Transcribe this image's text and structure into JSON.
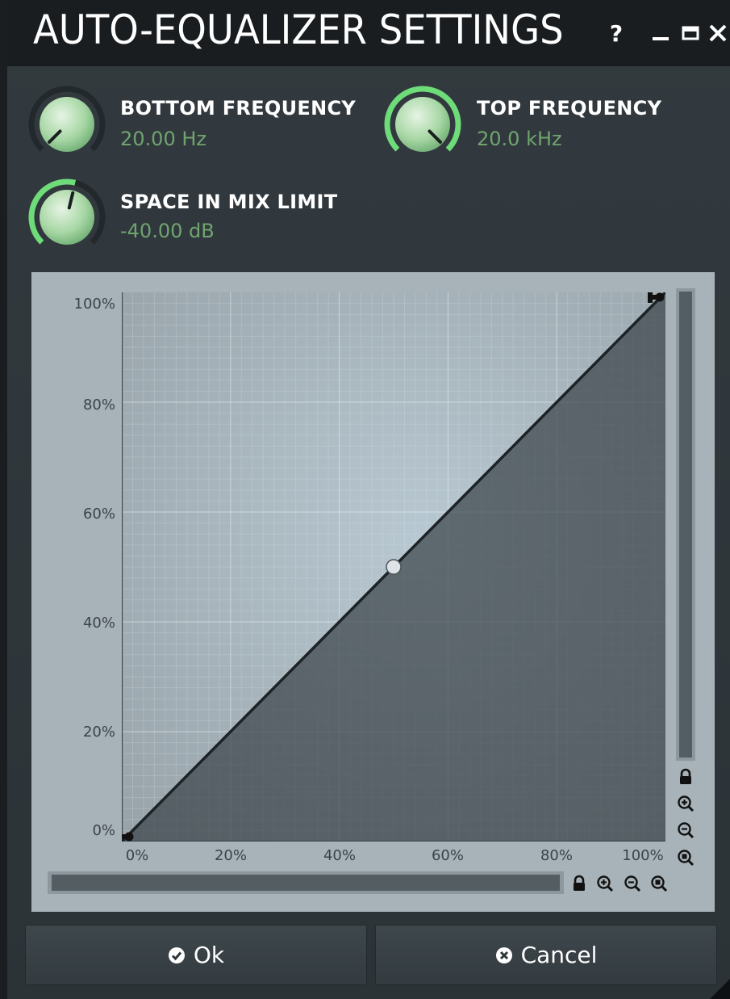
{
  "window": {
    "title": "AUTO-EQUALIZER SETTINGS",
    "controls": {
      "help": "?",
      "minimize": "–",
      "maximize": "▭",
      "close": "✕"
    }
  },
  "knobs": [
    {
      "label": "BOTTOM FREQUENCY",
      "value": "20.00 Hz",
      "level": 0.0
    },
    {
      "label": "TOP FREQUENCY",
      "value": "20.0 kHz",
      "level": 1.0
    },
    {
      "label": "SPACE IN MIX LIMIT",
      "value": "-40.00 dB",
      "level": 0.55
    }
  ],
  "graph": {
    "y_ticks": [
      "100%",
      "80%",
      "60%",
      "40%",
      "20%",
      "0%"
    ],
    "x_ticks": [
      "0%",
      "20%",
      "40%",
      "60%",
      "80%",
      "100%"
    ],
    "curve_points": [
      [
        0,
        0
      ],
      [
        50,
        50
      ],
      [
        100,
        100
      ]
    ],
    "colors": {
      "accent": "#6fdc7a",
      "value_text": "#6fa46f",
      "curve": "#1c2226"
    }
  },
  "footer": {
    "ok_label": "Ok",
    "cancel_label": "Cancel"
  }
}
